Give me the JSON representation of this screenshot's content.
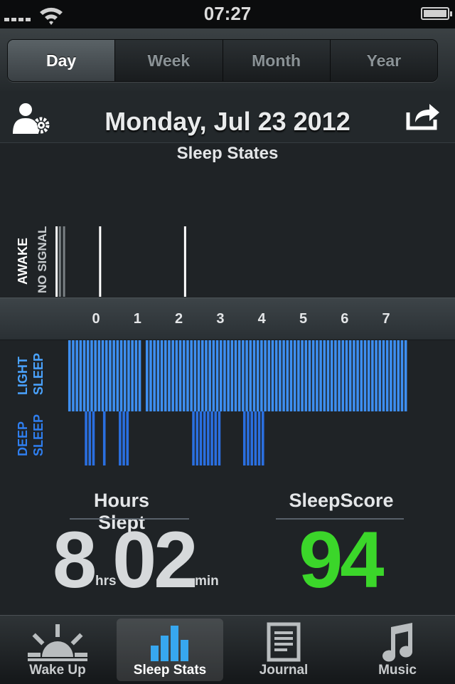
{
  "status_bar": {
    "time": "07:27"
  },
  "segments": [
    {
      "label": "Day",
      "active": true
    },
    {
      "label": "Week",
      "active": false
    },
    {
      "label": "Month",
      "active": false
    },
    {
      "label": "Year",
      "active": false
    }
  ],
  "header": {
    "date": "Monday, Jul 23 2012"
  },
  "chart": {
    "title": "Sleep States",
    "awake_label": "AWAKE",
    "no_signal_label": "NO SIGNAL",
    "light_label": [
      "LIGHT",
      "SLEEP"
    ],
    "deep_label": [
      "DEEP",
      "SLEEP"
    ],
    "colors": {
      "light": "#3d8ef0",
      "deep": "#2a6fe0",
      "awake": "#ffffff",
      "no_signal": "#7a8084"
    }
  },
  "chart_data": {
    "type": "bar",
    "title": "Sleep States",
    "x_ticks": [
      0,
      1,
      2,
      3,
      4,
      5,
      6,
      7
    ],
    "x_range": [
      -0.68,
      7.5
    ],
    "states": [
      "AWAKE",
      "NO SIGNAL",
      "LIGHT SLEEP",
      "DEEP SLEEP"
    ],
    "awake_times": [
      -0.95,
      0.1,
      2.15
    ],
    "no_signal_times": [
      -0.87,
      -0.77
    ],
    "light_sleep_ranges": [
      [
        -0.67,
        1.05
      ],
      [
        1.2,
        3.2
      ],
      [
        3.25,
        7.5
      ]
    ],
    "deep_sleep_ranges": [
      [
        -0.27,
        0.0
      ],
      [
        0.17,
        0.23
      ],
      [
        0.55,
        0.75
      ],
      [
        2.32,
        3.0
      ],
      [
        3.55,
        4.05
      ]
    ]
  },
  "stats": {
    "hours_slept_label": "Hours Slept",
    "hours": "8",
    "hours_unit": "hrs",
    "minutes": "02",
    "minutes_unit": "min",
    "score_label": "SleepScore",
    "score": "94"
  },
  "tabs": [
    {
      "label": "Wake Up",
      "icon": "sunrise-icon",
      "active": false
    },
    {
      "label": "Sleep Stats",
      "icon": "bar-chart-icon",
      "active": true
    },
    {
      "label": "Journal",
      "icon": "journal-icon",
      "active": false
    },
    {
      "label": "Music",
      "icon": "music-note-icon",
      "active": false
    }
  ]
}
